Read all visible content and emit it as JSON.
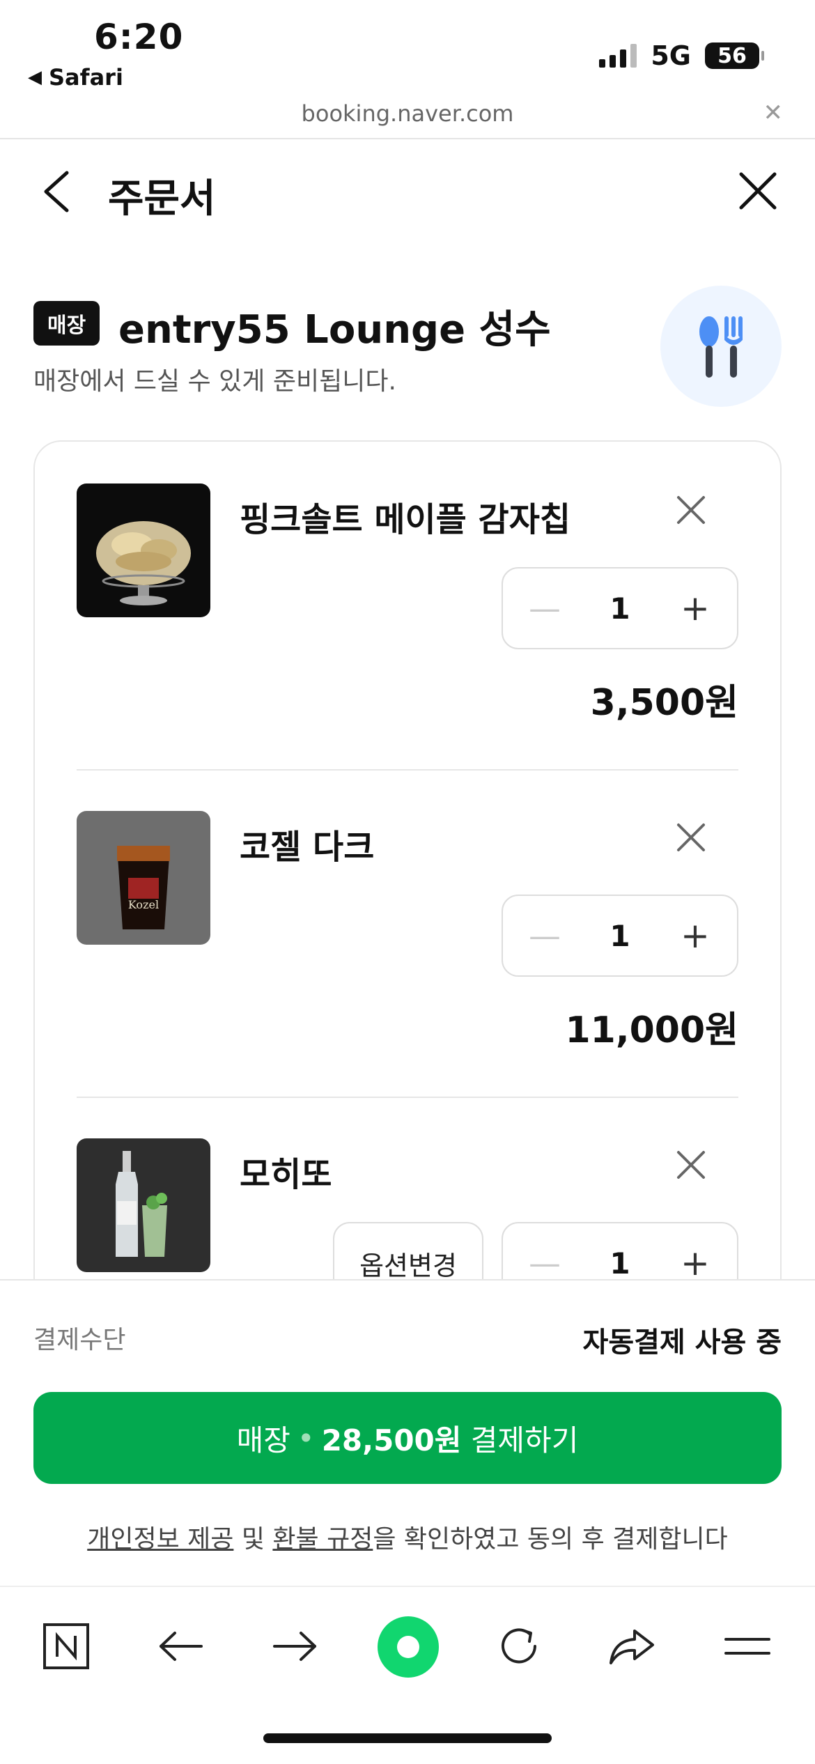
{
  "status_bar": {
    "time": "6:20",
    "back_app": "Safari",
    "network": "5G",
    "battery": "56"
  },
  "url_bar": {
    "url": "booking.naver.com"
  },
  "header": {
    "title": "주문서"
  },
  "store": {
    "tag": "매장",
    "name": "entry55 Lounge 성수",
    "subtitle": "매장에서 드실 수 있게 준비됩니다.",
    "icon": "utensils-icon"
  },
  "cart": {
    "items": [
      {
        "name": "핑크솔트 메이플 감자칩",
        "quantity": "1",
        "price": "3,500원"
      },
      {
        "name": "코젤 다크",
        "quantity": "1",
        "price": "11,000원"
      },
      {
        "name": "모히또",
        "quantity": "1",
        "option_label": "옵션변경"
      }
    ]
  },
  "payment": {
    "method_label": "결제수단",
    "method_value": "자동결제 사용 중",
    "button_prefix": "매장",
    "button_dot": "•",
    "button_amount": "28,500원",
    "button_suffix": "결제하기",
    "notice_link1": "개인정보 제공",
    "notice_mid": " 및 ",
    "notice_link2": "환불 규정",
    "notice_rest": "을 확인하였고 동의 후 결제합니다"
  },
  "colors": {
    "primary_green": "#03a94f",
    "badge_black": "#111111"
  }
}
